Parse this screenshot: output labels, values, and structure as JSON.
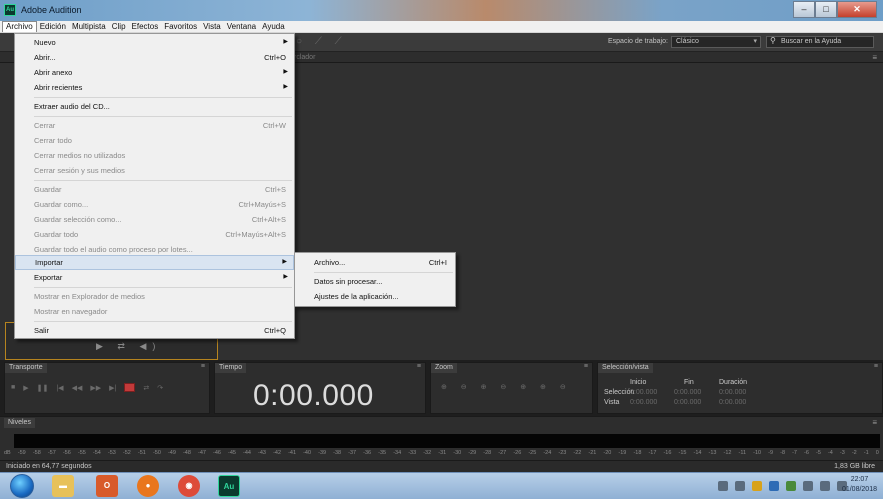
{
  "window": {
    "title": "Adobe Audition",
    "app_icon": "Au"
  },
  "menubar": [
    "Archivo",
    "Edición",
    "Multipista",
    "Clip",
    "Efectos",
    "Favoritos",
    "Vista",
    "Ventana",
    "Ayuda"
  ],
  "toolbar": {
    "workspace_label": "Espacio de trabajo:",
    "workspace_value": "Clásico",
    "search_placeholder": "Buscar en la Ayuda"
  },
  "editor": {
    "tab_label": "rclador"
  },
  "file_menu": {
    "nuevo": "Nuevo",
    "abrir": "Abrir...",
    "abrir_sc": "Ctrl+O",
    "abrir_anexo": "Abrir anexo",
    "abrir_recientes": "Abrir recientes",
    "extraer": "Extraer audio del CD...",
    "cerrar": "Cerrar",
    "cerrar_sc": "Ctrl+W",
    "cerrar_todo": "Cerrar todo",
    "cerrar_medios": "Cerrar medios no utilizados",
    "cerrar_sesion": "Cerrar sesión y sus medios",
    "guardar": "Guardar",
    "guardar_sc": "Ctrl+S",
    "guardar_como": "Guardar como...",
    "guardar_como_sc": "Ctrl+Mayús+S",
    "guardar_seleccion": "Guardar selección como...",
    "guardar_seleccion_sc": "Ctrl+Alt+S",
    "guardar_todo": "Guardar todo",
    "guardar_todo_sc": "Ctrl+Mayús+Alt+S",
    "guardar_todo_audio": "Guardar todo el audio como proceso por lotes...",
    "importar": "Importar",
    "exportar": "Exportar",
    "mostrar_explorador": "Mostrar en Explorador de medios",
    "mostrar_navegador": "Mostrar en navegador",
    "salir": "Salir",
    "salir_sc": "Ctrl+Q"
  },
  "import_submenu": {
    "archivo": "Archivo...",
    "archivo_sc": "Ctrl+I",
    "datos": "Datos sin procesar...",
    "ajustes": "Ajustes de la aplicación..."
  },
  "panels": {
    "transport": "Transporte",
    "time": "Tiempo",
    "time_value": "0:00.000",
    "zoom": "Zoom",
    "selection": "Selección/vista",
    "sel_headers": [
      "Inicio",
      "Fin",
      "Duración"
    ],
    "sel_row1": "Selección",
    "sel_row2": "Vista",
    "sel_val": "0:00.000",
    "levels": "Niveles"
  },
  "level_scale": [
    "dB",
    "-59",
    "-58",
    "-57",
    "-56",
    "-55",
    "-54",
    "-53",
    "-52",
    "-51",
    "-50",
    "-49",
    "-48",
    "-47",
    "-46",
    "-45",
    "-44",
    "-43",
    "-42",
    "-41",
    "-40",
    "-39",
    "-38",
    "-37",
    "-36",
    "-35",
    "-34",
    "-33",
    "-32",
    "-31",
    "-30",
    "-29",
    "-28",
    "-27",
    "-26",
    "-25",
    "-24",
    "-23",
    "-22",
    "-21",
    "-20",
    "-19",
    "-18",
    "-17",
    "-16",
    "-15",
    "-14",
    "-13",
    "-12",
    "-11",
    "-10",
    "-9",
    "-8",
    "-7",
    "-6",
    "-5",
    "-4",
    "-3",
    "-2",
    "-1",
    "0"
  ],
  "status": {
    "left": "Iniciado en 64,77 segundos",
    "right": "1,83 GB libre"
  },
  "clock": {
    "time": "22:07",
    "date": "01/08/2018"
  },
  "colors": {
    "accent_record": "#c23a3a",
    "menu_highlight": "#d9e4f1",
    "panel_bg": "#2d2d2d"
  }
}
